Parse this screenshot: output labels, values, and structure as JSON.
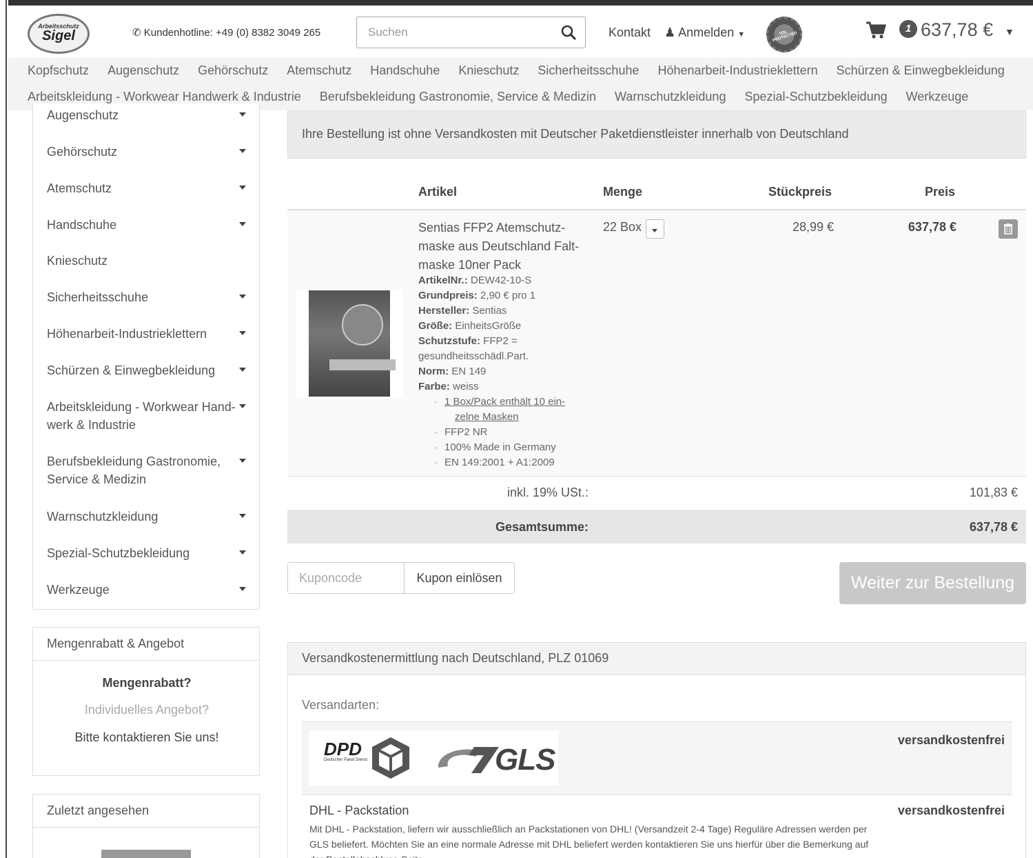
{
  "header": {
    "logo_top": "Arbeitsschutz",
    "logo_main": "Sigel",
    "hotline": "Kundenhotline: +49 (0) 8382 3049 265",
    "search_placeholder": "Suchen",
    "kontakt": "Kontakt",
    "anmelden": "Anmelden",
    "ssl_badge": "SSL PROTECTED",
    "cart_count": "1",
    "cart_total": "637,78 €"
  },
  "catnav": {
    "row1": [
      "Kopfschutz",
      "Augenschutz",
      "Gehörschutz",
      "Atemschutz",
      "Handschuhe",
      "Knieschutz",
      "Sicherheitsschuhe",
      "Höhenarbeit-Industrieklettern",
      "Schürzen & Einwegbekleidung"
    ],
    "row2": [
      "Arbeitskleidung - Workwear Handwerk & Industrie",
      "Berufsbekleidung Gastronomie, Service & Medizin",
      "Warnschutzkleidung",
      "Spezial-Schutzbekleidung",
      "Werkzeuge"
    ]
  },
  "sidebar": {
    "items": [
      "Augenschutz",
      "Gehörschutz",
      "Atemschutz",
      "Handschuhe",
      "Knieschutz",
      "Sicherheitsschuhe",
      "Höhenarbeit-Industrieklettern",
      "Schürzen & Einwegbekleidung",
      "Arbeitskleidung - Workwear Hand-werk & Industrie",
      "Berufsbekleidung Gastronomie, Service & Medizin",
      "Warnschutzkleidung",
      "Spezial-Schutzbekleidung",
      "Werkzeuge"
    ],
    "rabatt_panel": {
      "title": "Mengenrabatt & Angebot",
      "question": "Mengenrabatt?",
      "subtitle": "Individuelles Angebot?",
      "contact": "Bitte kontaktieren Sie uns!"
    },
    "recent_panel": {
      "title": "Zuletzt angesehen"
    }
  },
  "cart": {
    "notice": "Ihre Bestellung ist ohne Versandkosten mit Deutscher Paketdienstleister innerhalb von Deutschland",
    "columns": {
      "article": "Artikel",
      "qty": "Menge",
      "unit_price": "Stückpreis",
      "price": "Preis"
    },
    "item": {
      "name": "Sentias FFP2 Atemschutz-maske aus Deutschland Falt-maske 10ner Pack",
      "attrs": [
        {
          "label": "ArtikelNr.:",
          "value": "DEW42-10-S"
        },
        {
          "label": "Grundpreis:",
          "value": "2,90 € pro 1"
        },
        {
          "label": "Hersteller:",
          "value": "Sentias"
        },
        {
          "label": "Größe:",
          "value": "EinheitsGröße"
        },
        {
          "label": "Schutzstufe:",
          "value": "FFP2 ="
        },
        {
          "label": "",
          "value": "gesundheitsschädl.Part."
        },
        {
          "label": "Norm:",
          "value": "EN 149"
        },
        {
          "label": "Farbe:",
          "value": "weiss"
        }
      ],
      "bullets": [
        "1 Box/Pack enthält 10 ein-",
        "zelne Masken",
        "FFP2 NR",
        "100% Made in Germany",
        "EN 149:2001 + A1:2009"
      ],
      "qty": "22 Box",
      "unit_price": "28,99 €",
      "line_price": "637,78 €"
    },
    "vat_label": "inkl. 19% USt.:",
    "vat_value": "101,83 €",
    "total_label": "Gesamtsumme:",
    "total_value": "637,78 €",
    "coupon_placeholder": "Kuponcode",
    "coupon_button": "Kupon einlösen",
    "checkout_button": "Weiter zur Bestellung"
  },
  "shipping": {
    "title": "Versandkostenermittlung nach Deutschland, PLZ 01069",
    "types_label": "Versandarten:",
    "carrier_logos": {
      "dpd": "DPD",
      "dpd_sub": "Deutscher Paket Dienst",
      "gls": "GLS"
    },
    "option1_cost": "versandkostenfrei",
    "option2_name": "DHL - Packstation",
    "option2_cost": "versandkostenfrei",
    "option2_desc": "Mit DHL - Packstation, liefern wir ausschließlich an Packstationen von DHL! (Versandzeit 2-4 Tage) Reguläre Adressen werden per GLS beliefert. Möchten Sie an eine normale Adresse mit DHL beliefert werden kontaktieren Sie uns hierfür über die Bemerkung auf der Bestellabschluss-Seite."
  }
}
